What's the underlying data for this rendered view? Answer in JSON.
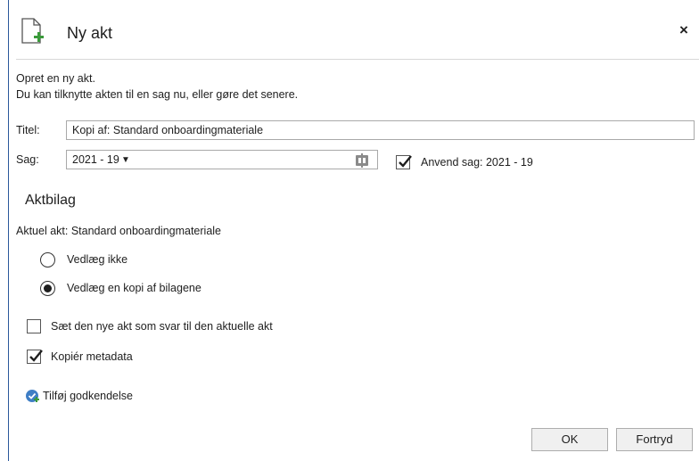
{
  "dialog": {
    "title": "Ny akt",
    "close_label": "×"
  },
  "intro": {
    "line1": "Opret en ny akt.",
    "line2": "Du kan tilknytte akten til en sag nu, eller gøre det senere."
  },
  "form": {
    "title_label": "Titel:",
    "title_value": "Kopi af: Standard onboardingmateriale",
    "case_label": "Sag:",
    "case_value": "2021 - 19",
    "use_case_checked": true,
    "use_case_label": "Anvend sag: 2021 - 19"
  },
  "attachments": {
    "heading": "Aktbilag",
    "current": "Aktuel akt: Standard onboardingmateriale",
    "options": [
      {
        "label": "Vedlæg ikke",
        "selected": false
      },
      {
        "label": "Vedlæg en kopi af bilagene",
        "selected": true
      }
    ]
  },
  "options": {
    "reply_label": "Sæt den nye akt som svar til den aktuelle akt",
    "reply_checked": false,
    "copy_metadata_label": "Kopiér metadata",
    "copy_metadata_checked": true
  },
  "approval": {
    "link_label": "Tilføj godkendelse",
    "icon": "approval-check-icon"
  },
  "buttons": {
    "ok": "OK",
    "cancel": "Fortryd"
  },
  "colors": {
    "accent": "#2b579a",
    "doc_plus": "#3a9a3a",
    "approval_icon": "#3f7ec5"
  }
}
